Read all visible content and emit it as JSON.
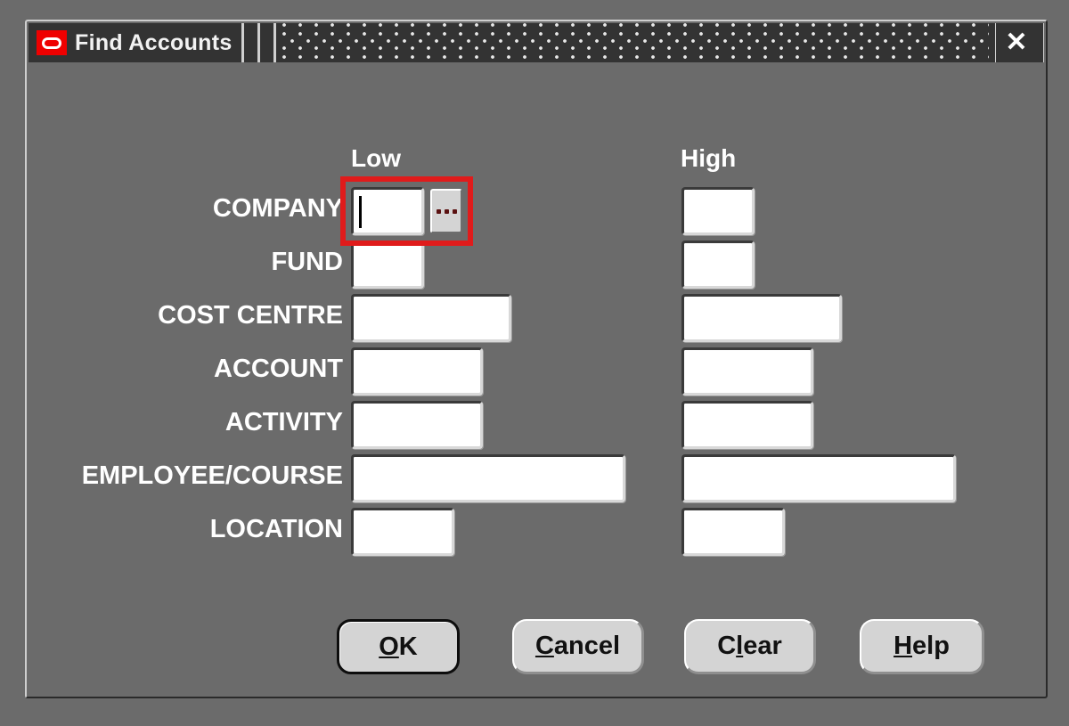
{
  "window": {
    "title": "Find Accounts",
    "logo_icon": "oracle-logo-icon",
    "close_icon": "✕",
    "titlebar_color": "#333333",
    "logo_color": "#ef0000",
    "background_color": "#6b6b6b"
  },
  "columns": {
    "low_label": "Low",
    "high_label": "High"
  },
  "highlight": {
    "color": "#e01b1b",
    "target": "company-low-field"
  },
  "lov": {
    "label": "...",
    "dot_color": "#5a1111"
  },
  "rows": [
    {
      "label": "COMPANY",
      "low_value": "",
      "high_value": "",
      "low_placeholder": "",
      "high_placeholder": "",
      "has_lov": true,
      "focused": true
    },
    {
      "label": "FUND",
      "low_value": "",
      "high_value": "",
      "low_placeholder": "",
      "high_placeholder": "",
      "has_lov": false,
      "focused": false
    },
    {
      "label": "COST CENTRE",
      "low_value": "",
      "high_value": "",
      "low_placeholder": "",
      "high_placeholder": "",
      "has_lov": false,
      "focused": false
    },
    {
      "label": "ACCOUNT",
      "low_value": "",
      "high_value": "",
      "low_placeholder": "",
      "high_placeholder": "",
      "has_lov": false,
      "focused": false
    },
    {
      "label": "ACTIVITY",
      "low_value": "",
      "high_value": "",
      "low_placeholder": "",
      "high_placeholder": "",
      "has_lov": false,
      "focused": false
    },
    {
      "label": "EMPLOYEE/COURSE",
      "low_value": "",
      "high_value": "",
      "low_placeholder": "",
      "high_placeholder": "",
      "has_lov": false,
      "focused": false
    },
    {
      "label": "LOCATION",
      "low_value": "",
      "high_value": "",
      "low_placeholder": "",
      "high_placeholder": "",
      "has_lov": false,
      "focused": false
    }
  ],
  "buttons": [
    {
      "label": "OK",
      "mnemonic": "O",
      "rest": "K",
      "default": true
    },
    {
      "label": "Cancel",
      "mnemonic": "C",
      "rest": "ancel",
      "default": false
    },
    {
      "label": "Clear",
      "mnemonic": "l",
      "pre": "C",
      "rest": "ear",
      "default": false
    },
    {
      "label": "Help",
      "mnemonic": "H",
      "rest": "elp",
      "default": false
    }
  ]
}
